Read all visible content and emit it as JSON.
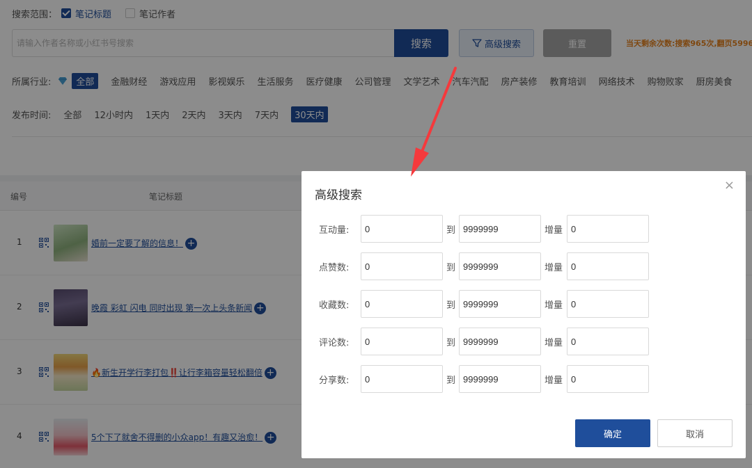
{
  "scope": {
    "label": "搜索范围：",
    "options": [
      {
        "label": "笔记标题",
        "checked": true
      },
      {
        "label": "笔记作者",
        "checked": false
      }
    ]
  },
  "search": {
    "placeholder": "请输入作者名称或小红书号搜索",
    "value": "",
    "search_label": "搜索",
    "advanced_label": "高级搜索",
    "reset_label": "重置",
    "quota_text": "当天剩余次数:搜索965次,翻页5996"
  },
  "industry": {
    "label": "所属行业:",
    "items": [
      "全部",
      "金融财经",
      "游戏应用",
      "影视娱乐",
      "生活服务",
      "医疗健康",
      "公司管理",
      "文学艺术",
      "汽车汽配",
      "房产装修",
      "教育培训",
      "网络技术",
      "购物败家",
      "厨房美食"
    ],
    "active_index": 0
  },
  "publish_time": {
    "label": "发布时间:",
    "items": [
      "全部",
      "12小时内",
      "1天内",
      "2天内",
      "3天内",
      "7天内",
      "30天内"
    ],
    "active_index": 6
  },
  "table": {
    "headers": {
      "no": "编号",
      "title": "笔记标题"
    },
    "rows": [
      {
        "no": "1",
        "title": "婚前一定要了解的信息！"
      },
      {
        "no": "2",
        "title": "晚霞 彩虹 闪电 同时出现 第一次上头条新闻"
      },
      {
        "no": "3",
        "title": "🔥新生开学行李打包‼️让行李箱容量轻松翻倍"
      },
      {
        "no": "4",
        "title": "5个下了就舍不得删的小众app！有趣又治愈！"
      }
    ]
  },
  "modal": {
    "title": "高级搜索",
    "close_symbol": "×",
    "to_label": "到",
    "increment_label": "增量",
    "rows": [
      {
        "label": "互动量:",
        "min": "0",
        "max": "9999999",
        "increment": "0"
      },
      {
        "label": "点赞数:",
        "min": "0",
        "max": "9999999",
        "increment": "0"
      },
      {
        "label": "收藏数:",
        "min": "0",
        "max": "9999999",
        "increment": "0"
      },
      {
        "label": "评论数:",
        "min": "0",
        "max": "9999999",
        "increment": "0"
      },
      {
        "label": "分享数:",
        "min": "0",
        "max": "9999999",
        "increment": "0"
      }
    ],
    "confirm_label": "确定",
    "cancel_label": "取消"
  },
  "colors": {
    "primary": "#1f4e9b",
    "quota": "#e6821e",
    "annotation_arrow": "#f5393c"
  }
}
